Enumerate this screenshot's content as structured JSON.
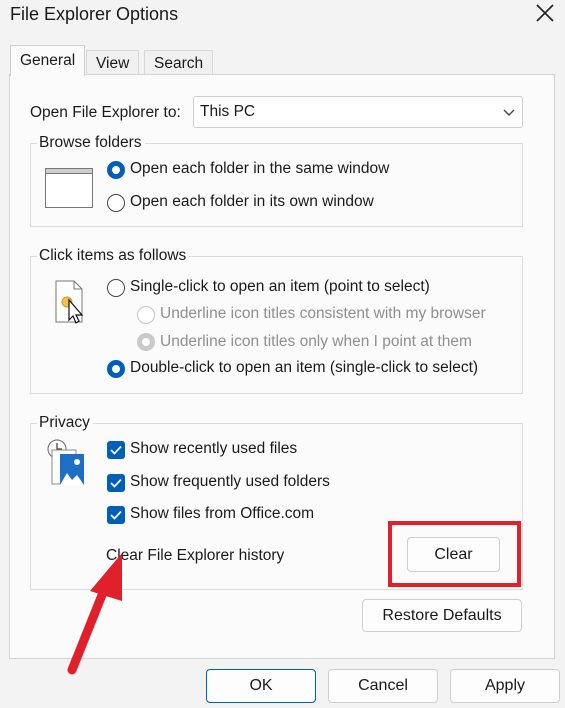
{
  "window": {
    "title": "File Explorer Options"
  },
  "tabs": [
    {
      "label": "General",
      "active": true
    },
    {
      "label": "View",
      "active": false
    },
    {
      "label": "Search",
      "active": false
    }
  ],
  "open_to": {
    "label": "Open File Explorer to:",
    "value": "This PC"
  },
  "browse_folders": {
    "title": "Browse folders",
    "options": [
      {
        "label": "Open each folder in the same window",
        "selected": true
      },
      {
        "label": "Open each folder in its own window",
        "selected": false
      }
    ]
  },
  "click_items": {
    "title": "Click items as follows",
    "single_click": {
      "label": "Single-click to open an item (point to select)",
      "selected": false
    },
    "underline_browser": {
      "label": "Underline icon titles consistent with my browser",
      "selected": false,
      "enabled": false
    },
    "underline_point": {
      "label": "Underline icon titles only when I point at them",
      "selected": true,
      "enabled": false
    },
    "double_click": {
      "label": "Double-click to open an item (single-click to select)",
      "selected": true
    }
  },
  "privacy": {
    "title": "Privacy",
    "checks": [
      {
        "label": "Show recently used files",
        "checked": true
      },
      {
        "label": "Show frequently used folders",
        "checked": true
      },
      {
        "label": "Show files from Office.com",
        "checked": true
      }
    ],
    "clear_history_label": "Clear File Explorer history",
    "clear_button": "Clear"
  },
  "restore_defaults": "Restore Defaults",
  "footer": {
    "ok": "OK",
    "cancel": "Cancel",
    "apply": "Apply"
  },
  "colors": {
    "accent": "#005fb8",
    "highlight": "#e0202b"
  }
}
